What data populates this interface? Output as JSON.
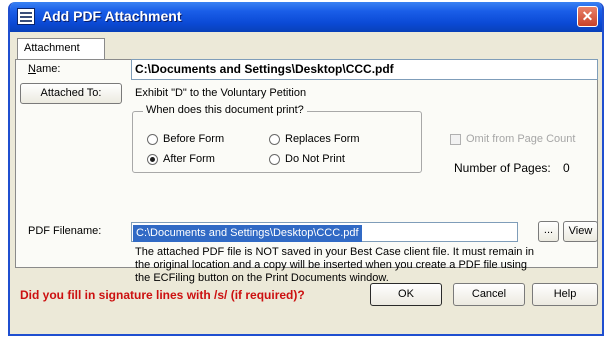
{
  "window": {
    "title": "Add PDF Attachment",
    "close_glyph": "✕",
    "accent_color": "#0b4ad6"
  },
  "tab": {
    "label": "Attachment"
  },
  "form": {
    "name_label": "Name:",
    "name_value": "C:\\Documents and Settings\\Desktop\\CCC.pdf",
    "attached_to_button": "Attached To:",
    "attached_to_value": "Exhibit \"D\" to the Voluntary Petition",
    "print_group_title": "When does this document print?",
    "print_options": [
      {
        "label": "Before Form",
        "selected": false
      },
      {
        "label": "Replaces Form",
        "selected": false
      },
      {
        "label": "After Form",
        "selected": true
      },
      {
        "label": "Do Not Print",
        "selected": false
      }
    ],
    "omit_label": "Omit from Page Count",
    "omit_checked": false,
    "omit_enabled": false,
    "pages_label": "Number of Pages:",
    "pages_value": "0",
    "pdf_label": "PDF Filename:",
    "pdf_value": "C:\\Documents and Settings\\Desktop\\CCC.pdf",
    "browse_button": "...",
    "view_button": "View",
    "note_lines": [
      "The attached PDF file is NOT saved in your Best Case client file. It must remain in",
      "the original location and a copy will be inserted when you create a PDF file using",
      "the ECFiling button on the Print Documents window."
    ]
  },
  "footer": {
    "warning": "Did you fill in signature lines with /s/ (if required)?",
    "warning_color": "#cc1010",
    "ok_button": "OK",
    "cancel_button": "Cancel",
    "help_button": "Help"
  }
}
